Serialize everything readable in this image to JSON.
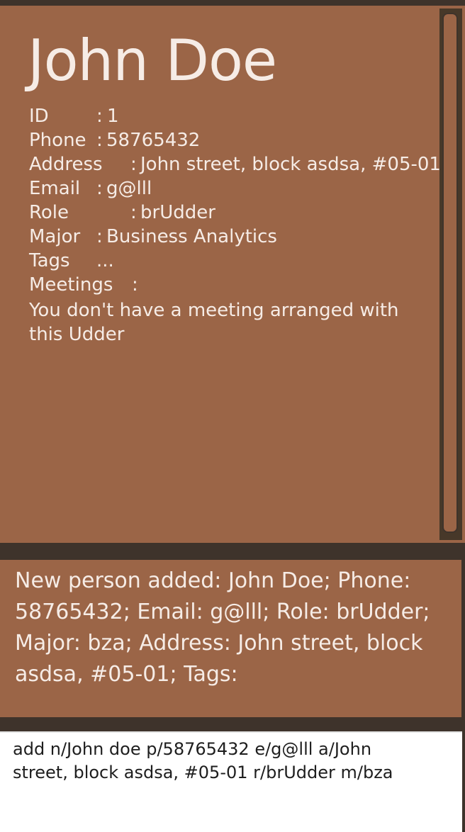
{
  "person": {
    "name": "John Doe",
    "fields": [
      {
        "label": "ID",
        "colon": ":",
        "value": "1"
      },
      {
        "label": "Phone",
        "colon": ":",
        "value": "58765432"
      },
      {
        "label": "Address",
        "colon": ":",
        "value": "John street, block asdsa, #05-01"
      },
      {
        "label": "Email",
        "colon": ":",
        "value": "g@lll"
      },
      {
        "label": "Role",
        "colon": ":",
        "value": "brUdder"
      },
      {
        "label": "Major",
        "colon": ":",
        "value": "Business Analytics"
      },
      {
        "label": "Tags",
        "colon": "...",
        "value": ""
      },
      {
        "label": "Meetings",
        "colon": ":",
        "value": ""
      }
    ],
    "meeting_note": "You don't have a meeting arranged with this Udder"
  },
  "result": {
    "message": "New person added: John Doe; Phone: 58765432; Email: g@lll; Role: brUdder; Major: bza; Address: John street, block asdsa, #05-01; Tags:"
  },
  "command": {
    "value": "add n/John doe p/58765432 e/g@lll a/John street, block asdsa, #05-01 r/brUdder m/bza"
  },
  "colors": {
    "panel": "#9b6547",
    "background": "#3e332b",
    "text": "#f6ece6"
  }
}
